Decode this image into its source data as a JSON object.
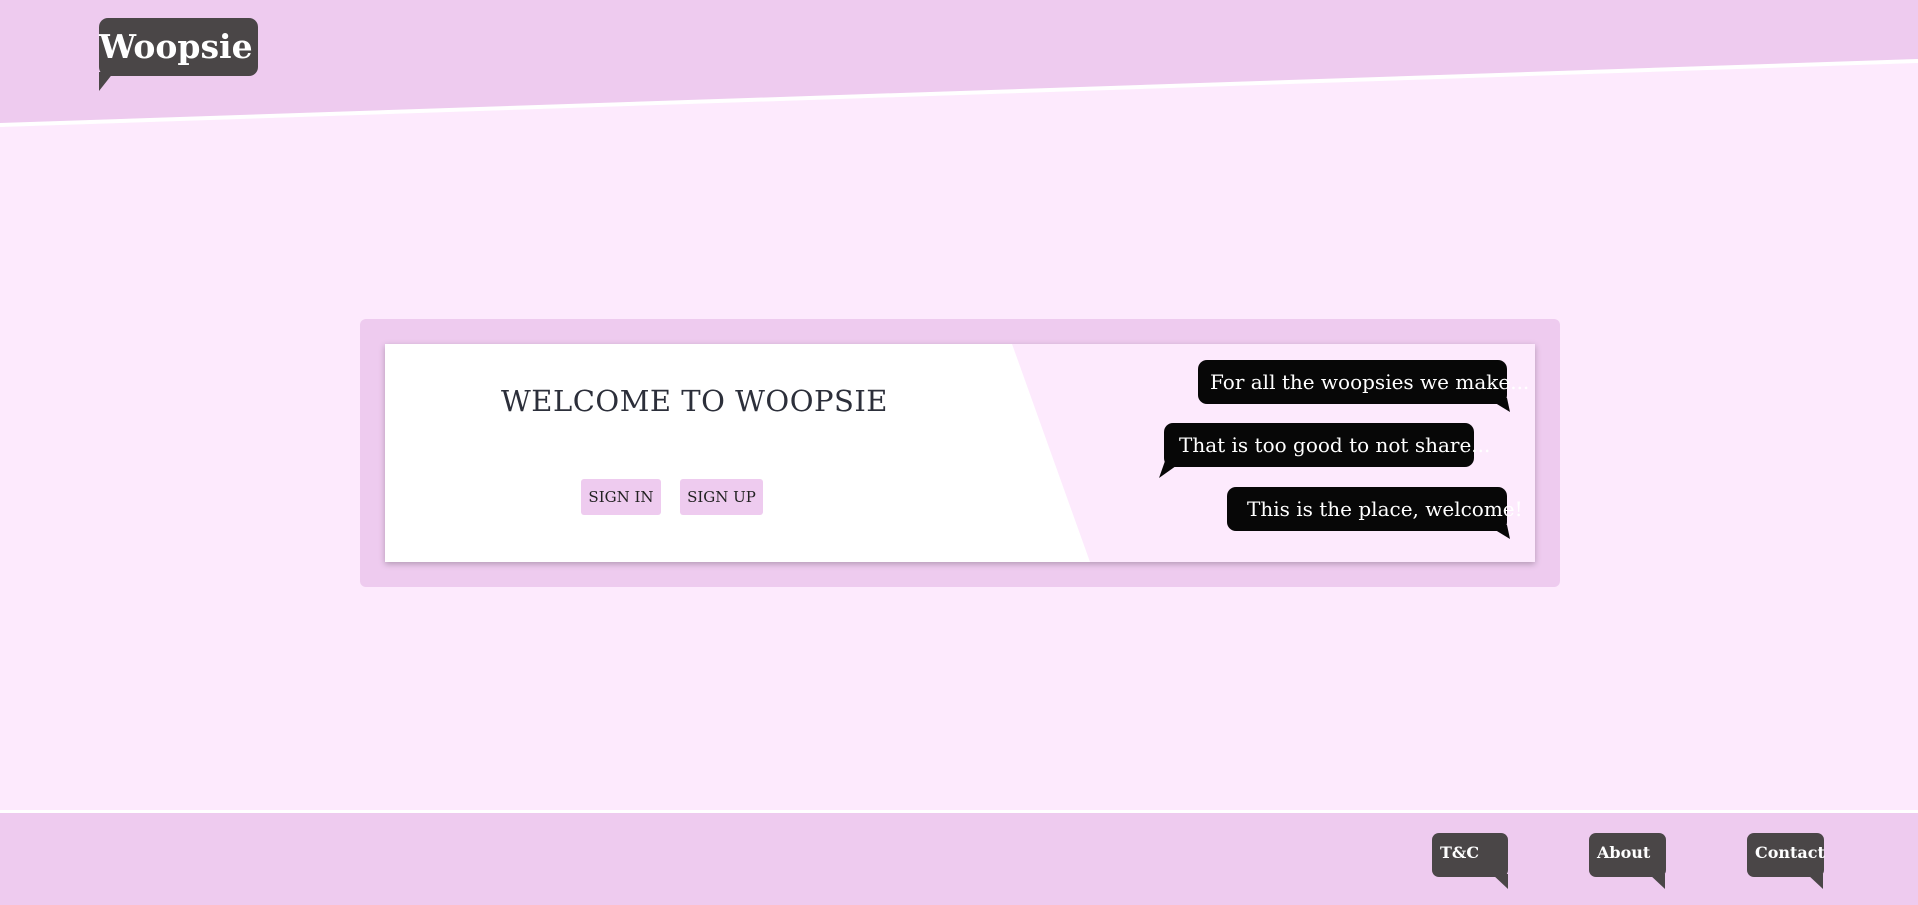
{
  "brand": {
    "logo_text": "Woopsie"
  },
  "welcome": {
    "title": "WELCOME TO WOOPSIE",
    "sign_in_label": "SIGN IN",
    "sign_up_label": "SIGN UP"
  },
  "bubbles": [
    "For all the woopsies we make...",
    "That is too good to not share...",
    "This is the place, welcome!"
  ],
  "footer": {
    "links": [
      "T&C",
      "About",
      "Contact"
    ]
  },
  "colors": {
    "page_background": "#fdeafd",
    "accent_pink": "#eecbef",
    "dark_bubble": "#070707",
    "logo_gray": "#4a4647"
  }
}
